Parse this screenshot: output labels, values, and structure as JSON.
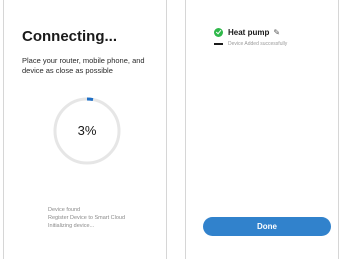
{
  "connecting_screen": {
    "title": "Connecting...",
    "instruction": "Place your router, mobile phone, and device as close as possible",
    "progress": {
      "value": 0.03,
      "label": "3%"
    },
    "steps": [
      "Device found",
      "Register Device to Smart Cloud",
      "Initializing device..."
    ],
    "colors": {
      "progress_track": "#e6e6e6",
      "progress_fill": "#1f6fc5"
    }
  },
  "done_screen": {
    "device": {
      "name": "Heat pump",
      "status": "Device Added successfully",
      "status_icon": "check-circle-icon",
      "edit_icon": "pencil-icon"
    },
    "done_label": "Done",
    "colors": {
      "accent": "#3182cc",
      "success": "#2fb84a"
    }
  }
}
